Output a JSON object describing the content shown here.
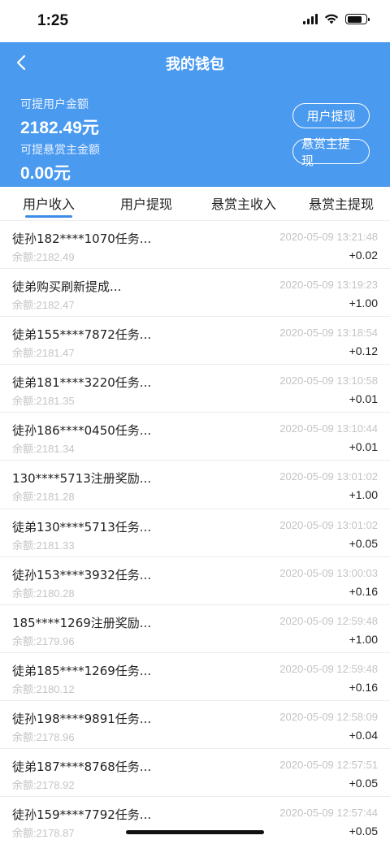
{
  "status_bar": {
    "time": "1:25"
  },
  "header": {
    "title": "我的钱包",
    "user_balance_label": "可提用户金额",
    "user_balance_value": "2182.49元",
    "bounty_balance_label": "可提悬赏主金额",
    "bounty_balance_value": "0.00元",
    "user_withdraw_button": "用户提现",
    "bounty_withdraw_button": "悬赏主提现"
  },
  "tabs": [
    {
      "label": "用户收入",
      "active": true
    },
    {
      "label": "用户提现",
      "active": false
    },
    {
      "label": "悬赏主收入",
      "active": false
    },
    {
      "label": "悬赏主提现",
      "active": false
    }
  ],
  "colors": {
    "header_bg": "#4a9af0",
    "tab_underline": "#3d8be8",
    "muted_text": "#c4c4c4"
  },
  "transactions": [
    {
      "title": "徒孙182****1070任务...",
      "time": "2020-05-09 13:21:48",
      "balance": "余额:2182.49",
      "amount": "+0.02"
    },
    {
      "title": "徒弟购买刷新提成...",
      "time": "2020-05-09 13:19:23",
      "balance": "余额:2182.47",
      "amount": "+1.00"
    },
    {
      "title": "徒弟155****7872任务...",
      "time": "2020-05-09 13:18:54",
      "balance": "余额:2181.47",
      "amount": "+0.12"
    },
    {
      "title": "徒弟181****3220任务...",
      "time": "2020-05-09 13:10:58",
      "balance": "余额:2181.35",
      "amount": "+0.01"
    },
    {
      "title": "徒孙186****0450任务...",
      "time": "2020-05-09 13:10:44",
      "balance": "余额:2181.34",
      "amount": "+0.01"
    },
    {
      "title": "130****5713注册奖励...",
      "time": "2020-05-09 13:01:02",
      "balance": "余额:2181.28",
      "amount": "+1.00"
    },
    {
      "title": "徒弟130****5713任务...",
      "time": "2020-05-09 13:01:02",
      "balance": "余额:2181.33",
      "amount": "+0.05"
    },
    {
      "title": "徒孙153****3932任务...",
      "time": "2020-05-09 13:00:03",
      "balance": "余额:2180.28",
      "amount": "+0.16"
    },
    {
      "title": "185****1269注册奖励...",
      "time": "2020-05-09 12:59:48",
      "balance": "余额:2179.96",
      "amount": "+1.00"
    },
    {
      "title": "徒弟185****1269任务...",
      "time": "2020-05-09 12:59:48",
      "balance": "余额:2180.12",
      "amount": "+0.16"
    },
    {
      "title": "徒孙198****9891任务...",
      "time": "2020-05-09 12:58:09",
      "balance": "余额:2178.96",
      "amount": "+0.04"
    },
    {
      "title": "徒弟187****8768任务...",
      "time": "2020-05-09 12:57:51",
      "balance": "余额:2178.92",
      "amount": "+0.05"
    },
    {
      "title": "徒孙159****7792任务...",
      "time": "2020-05-09 12:57:44",
      "balance": "余额:2178.87",
      "amount": "+0.05"
    }
  ]
}
